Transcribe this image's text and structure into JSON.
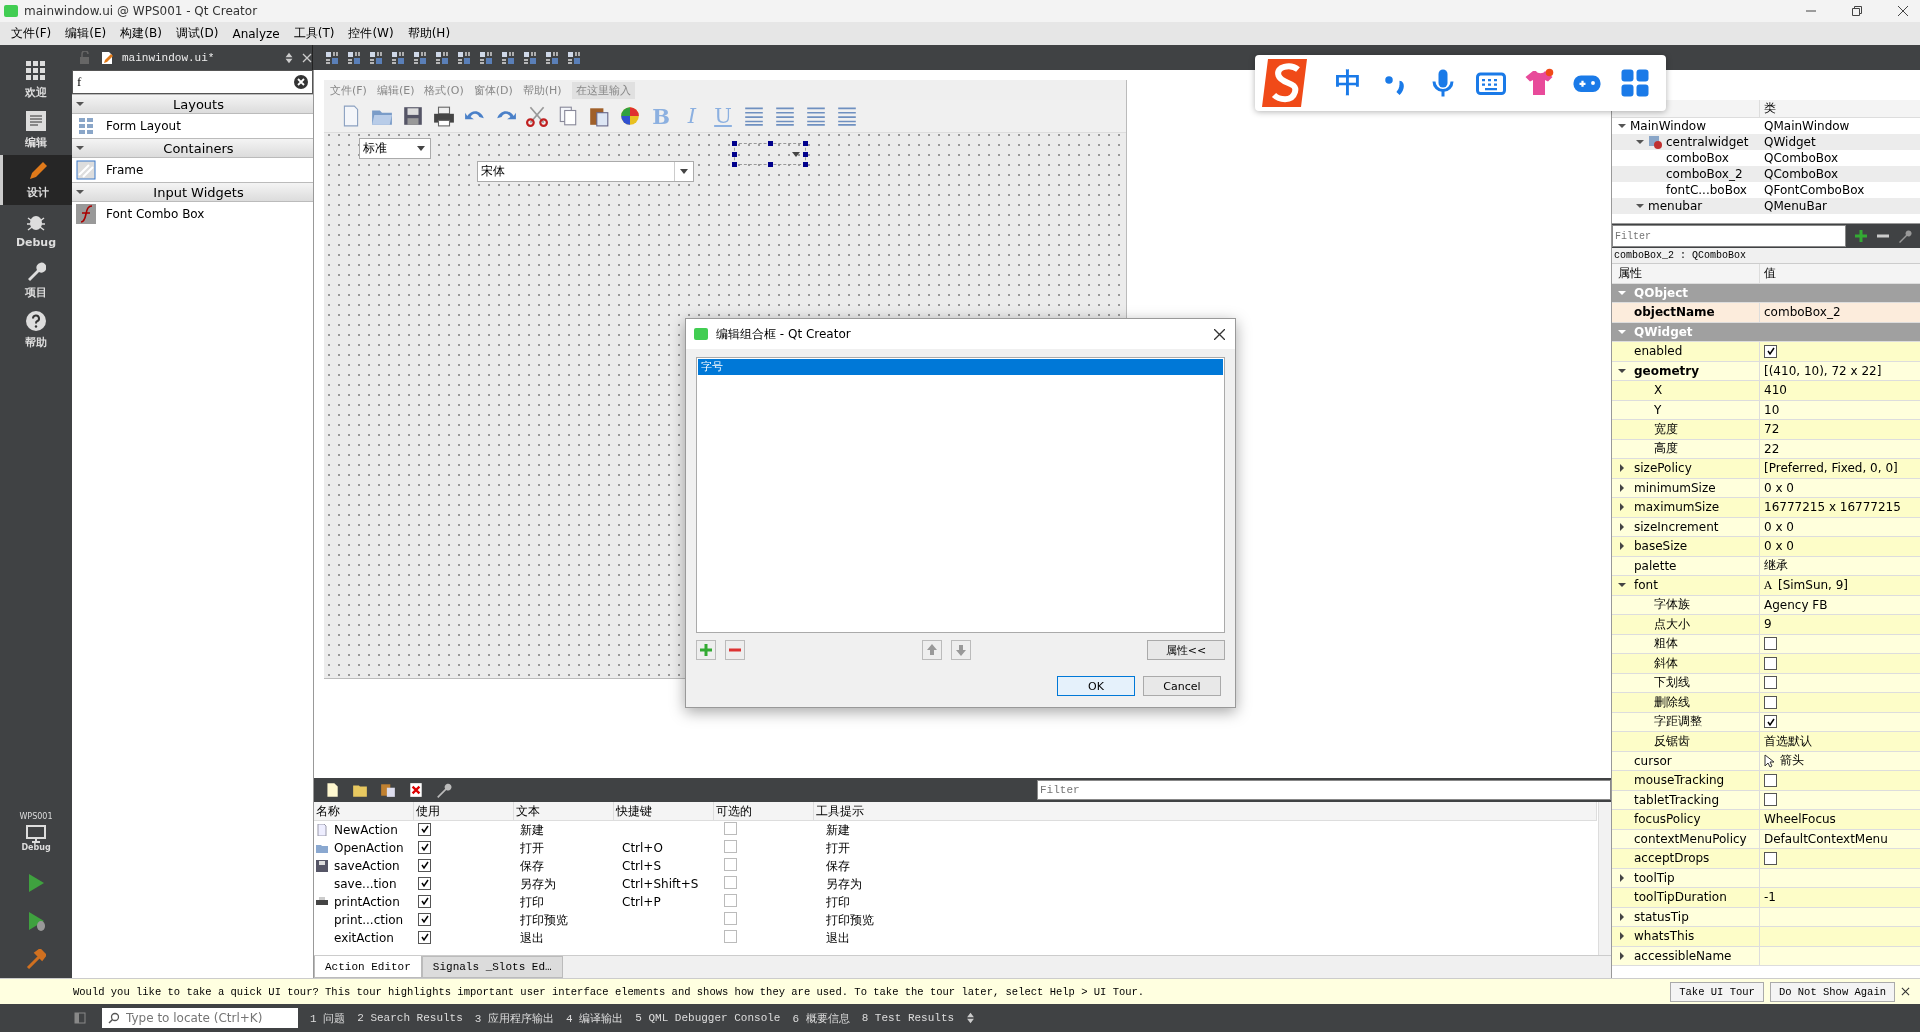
{
  "window": {
    "title": "mainwindow.ui @ WPS001 - Qt Creator"
  },
  "menu": [
    "文件(F)",
    "编辑(E)",
    "构建(B)",
    "调试(D)",
    "Analyze",
    "工具(T)",
    "控件(W)",
    "帮助(H)"
  ],
  "modes": [
    {
      "label": "欢迎",
      "selected": false
    },
    {
      "label": "编辑",
      "selected": false
    },
    {
      "label": "设计",
      "selected": true
    },
    {
      "label": "Debug",
      "selected": false
    },
    {
      "label": "项目",
      "selected": false
    },
    {
      "label": "帮助",
      "selected": false
    }
  ],
  "kit": {
    "project": "WPS001",
    "mode": "Debug"
  },
  "editor_toolbar": {
    "file": "mainwindow.ui*"
  },
  "widget_box": {
    "search": "f",
    "groups": [
      {
        "title": "Layouts",
        "expanded": true,
        "items": [
          {
            "label": "Form Layout"
          }
        ]
      },
      {
        "title": "Containers",
        "expanded": true,
        "items": [
          {
            "label": "Frame"
          }
        ]
      },
      {
        "title": "Input Widgets",
        "expanded": true,
        "items": [
          {
            "label": "Font Combo Box"
          }
        ]
      }
    ]
  },
  "form": {
    "menu": [
      "文件(F)",
      "编辑(E)",
      "格式(O)",
      "窗体(D)",
      "帮助(H)"
    ],
    "menu_hint": "在这里输入",
    "format_buttons": [
      "B",
      "I",
      "U"
    ],
    "combo_size": "标准",
    "combo_font": "宋体"
  },
  "ime": {
    "mode": "中"
  },
  "dialog": {
    "title": "编辑组合框 - Qt Creator",
    "items": [
      {
        "label": "字号",
        "selected": true
      }
    ],
    "properties_button": "属性<<",
    "ok": "OK",
    "cancel": "Cancel"
  },
  "object_inspector": {
    "class_header": "类",
    "tree": [
      {
        "name": "MainWindow",
        "class": "QMainWindow",
        "expanded": true,
        "children": [
          {
            "name": "centralwidget",
            "class": "QWidget",
            "expanded": true,
            "children": [
              {
                "name": "comboBox",
                "class": "QComboBox"
              },
              {
                "name": "comboBox_2",
                "class": "QComboBox"
              },
              {
                "name": "fontC...boBox",
                "class": "QFontComboBox"
              }
            ]
          },
          {
            "name": "menubar",
            "class": "QMenuBar",
            "expanded": true
          }
        ]
      }
    ]
  },
  "property_editor": {
    "filter_placeholder": "Filter",
    "selection": "comboBox_2 : QComboBox",
    "headers": [
      "属性",
      "值"
    ],
    "rows": [
      {
        "kind": "section",
        "name": "QObject",
        "expanded": true
      },
      {
        "kind": "prop",
        "name": "objectName",
        "value": "comboBox_2",
        "modified": true
      },
      {
        "kind": "section",
        "name": "QWidget",
        "expanded": true
      },
      {
        "kind": "prop",
        "name": "enabled",
        "checked": true,
        "modified": false
      },
      {
        "kind": "prop",
        "name": "geometry",
        "value": "[(410, 10), 72 x 22]",
        "expanded": true,
        "modified": true
      },
      {
        "kind": "sub",
        "name": "X",
        "value": "410"
      },
      {
        "kind": "sub",
        "name": "Y",
        "value": "10"
      },
      {
        "kind": "sub",
        "name": "宽度",
        "value": "72"
      },
      {
        "kind": "sub",
        "name": "高度",
        "value": "22"
      },
      {
        "kind": "prop",
        "name": "sizePolicy",
        "value": "[Preferred, Fixed, 0, 0]",
        "expanded": false,
        "modified": false
      },
      {
        "kind": "prop",
        "name": "minimumSize",
        "value": "0 x 0",
        "expanded": false,
        "modified": false
      },
      {
        "kind": "prop",
        "name": "maximumSize",
        "value": "16777215 x 16777215",
        "expanded": false,
        "modified": false
      },
      {
        "kind": "prop",
        "name": "sizeIncrement",
        "value": "0 x 0",
        "expanded": false,
        "modified": false
      },
      {
        "kind": "prop",
        "name": "baseSize",
        "value": "0 x 0",
        "expanded": false,
        "modified": false
      },
      {
        "kind": "prop",
        "name": "palette",
        "value": "继承",
        "modified": false
      },
      {
        "kind": "prop",
        "name": "font",
        "value_prefix": "A",
        "value": "[SimSun, 9]",
        "expanded": true,
        "modified": false
      },
      {
        "kind": "sub",
        "name": "字体族",
        "value": "Agency FB"
      },
      {
        "kind": "sub",
        "name": "点大小",
        "value": "9"
      },
      {
        "kind": "sub",
        "name": "粗体",
        "checked": false
      },
      {
        "kind": "sub",
        "name": "斜体",
        "checked": false
      },
      {
        "kind": "sub",
        "name": "下划线",
        "checked": false
      },
      {
        "kind": "sub",
        "name": "删除线",
        "checked": false
      },
      {
        "kind": "sub",
        "name": "字距调整",
        "checked": true
      },
      {
        "kind": "sub",
        "name": "反锯齿",
        "value": "首选默认"
      },
      {
        "kind": "prop",
        "name": "cursor",
        "value": "箭头",
        "pointer": true,
        "modified": false
      },
      {
        "kind": "prop",
        "name": "mouseTracking",
        "checked": false,
        "modified": false
      },
      {
        "kind": "prop",
        "name": "tabletTracking",
        "checked": false,
        "modified": false
      },
      {
        "kind": "prop",
        "name": "focusPolicy",
        "value": "WheelFocus",
        "modified": false
      },
      {
        "kind": "prop",
        "name": "contextMenuPolicy",
        "value": "DefaultContextMenu",
        "modified": false
      },
      {
        "kind": "prop",
        "name": "acceptDrops",
        "checked": false,
        "modified": false
      },
      {
        "kind": "prop",
        "name": "toolTip",
        "expanded": false,
        "modified": false
      },
      {
        "kind": "prop",
        "name": "toolTipDuration",
        "value": "-1",
        "modified": false
      },
      {
        "kind": "prop",
        "name": "statusTip",
        "expanded": false,
        "modified": false
      },
      {
        "kind": "prop",
        "name": "whatsThis",
        "expanded": false,
        "modified": false
      },
      {
        "kind": "prop",
        "name": "accessibleName",
        "expanded": false,
        "modified": false
      }
    ]
  },
  "action_editor": {
    "filter_placeholder": "Filter",
    "columns": [
      "名称",
      "使用",
      "文本",
      "快捷键",
      "可选的",
      "工具提示"
    ],
    "rows": [
      {
        "name": "NewAction",
        "used": true,
        "text": "新建",
        "shortcut": "",
        "checkable": false,
        "tooltip": "新建"
      },
      {
        "name": "OpenAction",
        "used": true,
        "text": "打开",
        "shortcut": "Ctrl+O",
        "checkable": false,
        "tooltip": "打开"
      },
      {
        "name": "saveAction",
        "used": true,
        "text": "保存",
        "shortcut": "Ctrl+S",
        "checkable": false,
        "tooltip": "保存"
      },
      {
        "name": "save...tion",
        "used": true,
        "text": "另存为",
        "shortcut": "Ctrl+Shift+S",
        "checkable": false,
        "tooltip": "另存为"
      },
      {
        "name": "printAction",
        "used": true,
        "text": "打印",
        "shortcut": "Ctrl+P",
        "checkable": false,
        "tooltip": "打印"
      },
      {
        "name": "print...ction",
        "used": true,
        "text": "打印预览",
        "shortcut": "",
        "checkable": false,
        "tooltip": "打印预览"
      },
      {
        "name": "exitAction",
        "used": true,
        "text": "退出",
        "shortcut": "",
        "checkable": false,
        "tooltip": "退出"
      }
    ],
    "tabs": [
      {
        "label": "Action Editor",
        "selected": true
      },
      {
        "label": "Signals _Slots Ed…",
        "selected": false
      }
    ]
  },
  "tour": {
    "message": "Would you like to take a quick UI tour? This tour highlights important user interface elements and shows how they are used. To take the tour later, select Help > UI Tour.",
    "take": "Take UI Tour",
    "dismiss": "Do Not Show Again"
  },
  "status_bar": {
    "locator_placeholder": "Type to locate (Ctrl+K)",
    "panes": [
      "1 问题",
      "2 Search Results",
      "3 应用程序输出",
      "4 编译输出",
      "5 QML Debugger Console",
      "6 概要信息",
      "8 Test Results"
    ]
  }
}
